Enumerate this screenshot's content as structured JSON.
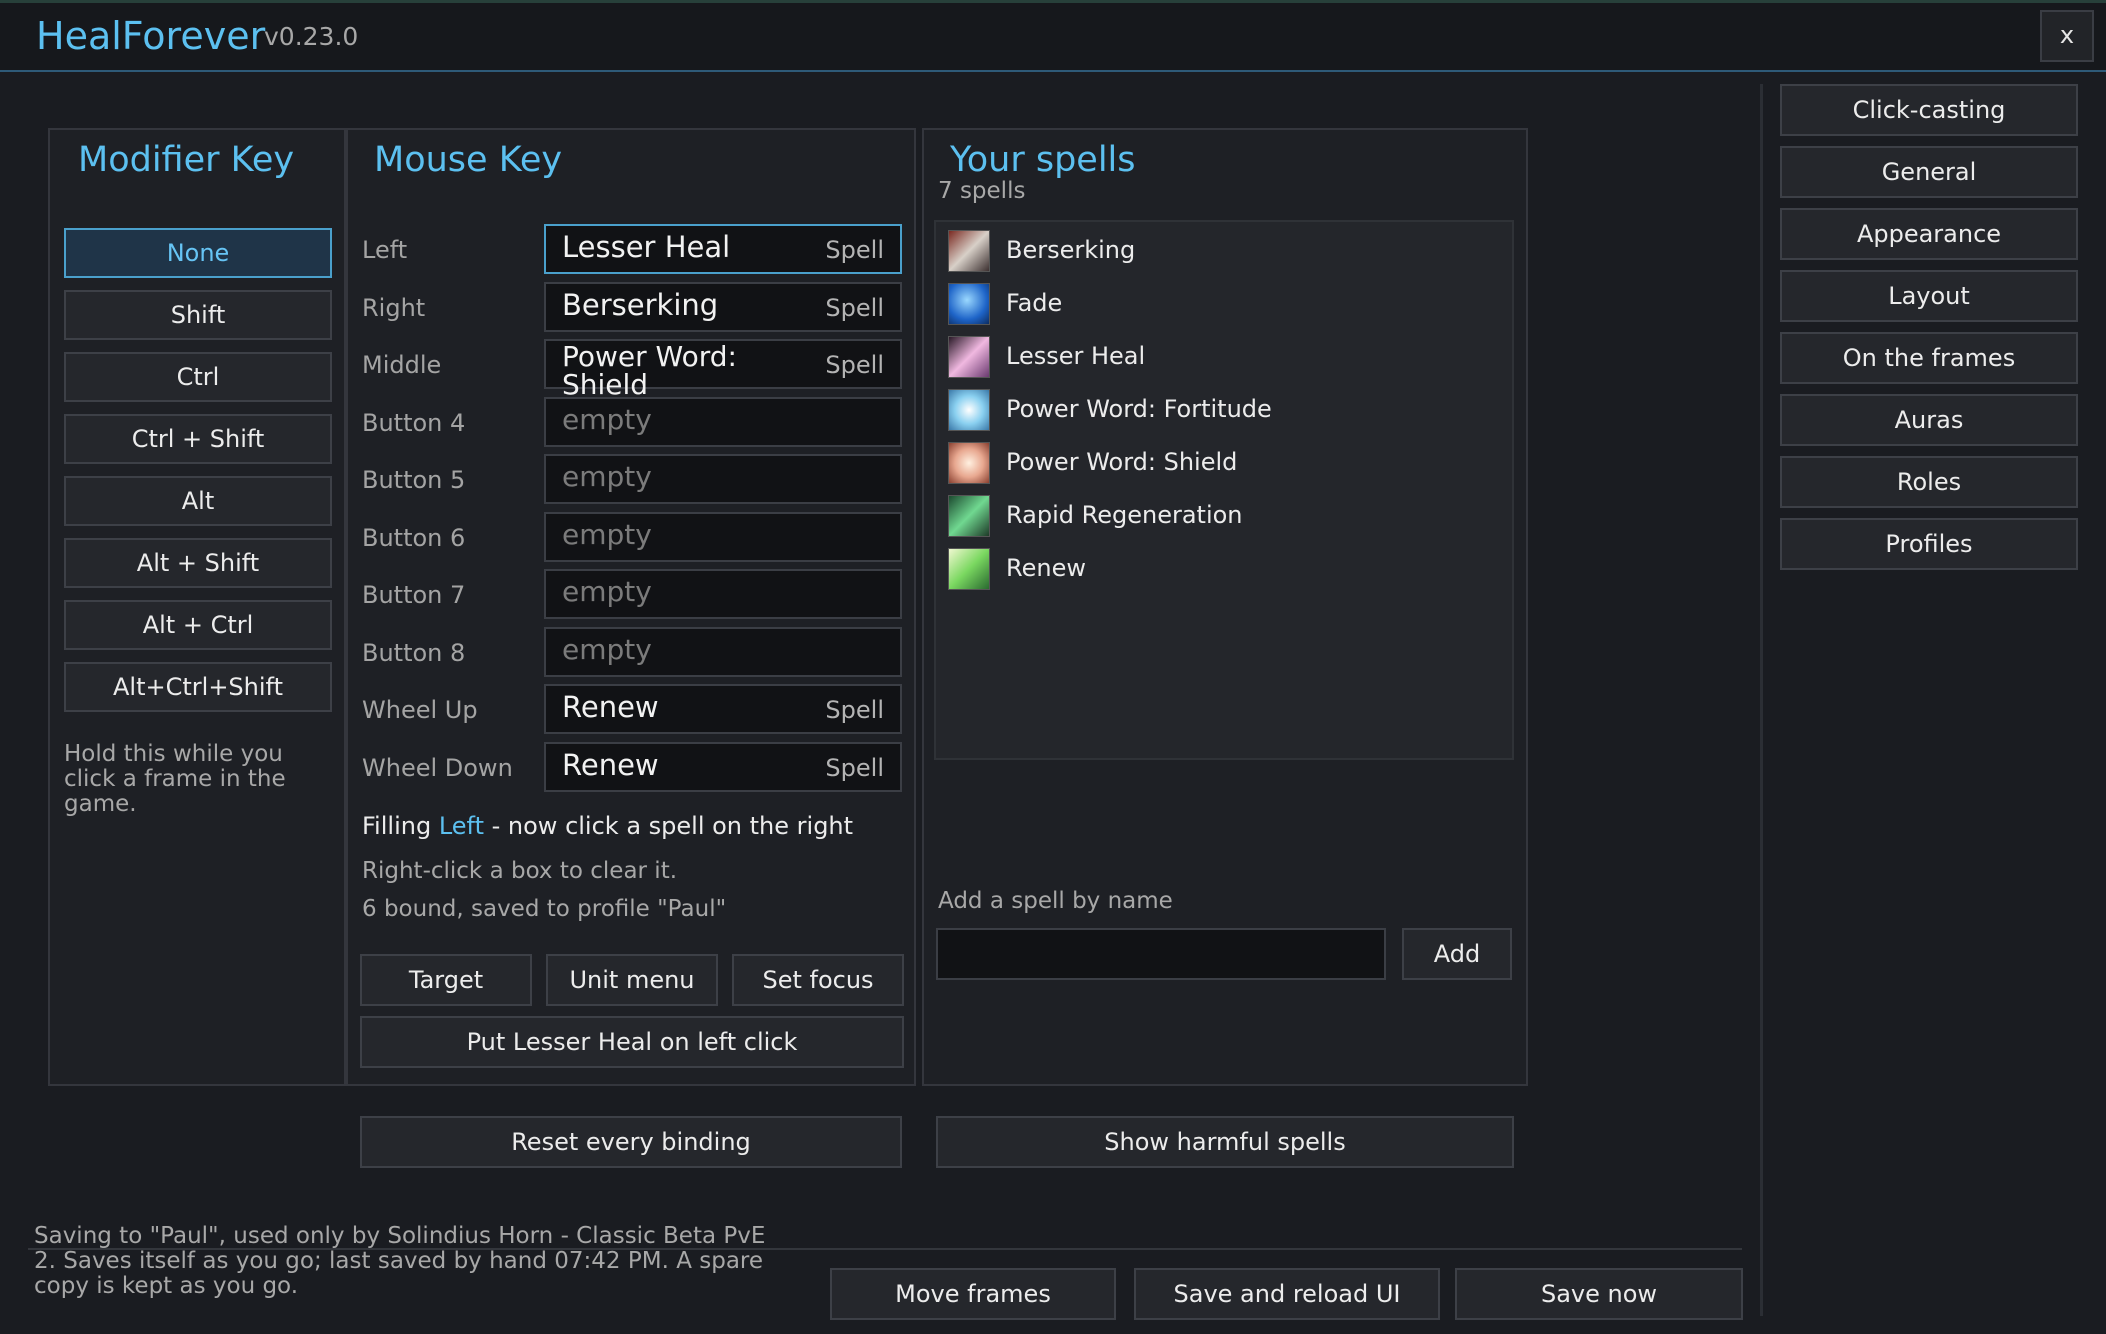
{
  "app": {
    "title": "HealForever",
    "version": "v0.23.0",
    "close_label": "x"
  },
  "modifier": {
    "title": "Modifier Key",
    "buttons": [
      "None",
      "Shift",
      "Ctrl",
      "Ctrl + Shift",
      "Alt",
      "Alt + Shift",
      "Alt + Ctrl",
      "Alt+Ctrl+Shift"
    ],
    "selected": "None",
    "hint_lines": [
      "Hold this while you",
      "click a frame in the",
      "game."
    ]
  },
  "mouse": {
    "title": "Mouse Key",
    "rows": [
      {
        "label": "Left",
        "spell": "Lesser Heal",
        "tag": "Spell"
      },
      {
        "label": "Right",
        "spell": "Berserking",
        "tag": "Spell"
      },
      {
        "label": "Middle",
        "spell_line1": "Power Word:",
        "spell_line2": "Shield",
        "tag": "Spell"
      },
      {
        "label": "Button 4",
        "empty": "empty"
      },
      {
        "label": "Button 5",
        "empty": "empty"
      },
      {
        "label": "Button 6",
        "empty": "empty"
      },
      {
        "label": "Button 7",
        "empty": "empty"
      },
      {
        "label": "Button 8",
        "empty": "empty"
      },
      {
        "label": "Wheel Up",
        "spell": "Renew",
        "tag": "Spell"
      },
      {
        "label": "Wheel Down",
        "spell": "Renew",
        "tag": "Spell"
      }
    ],
    "filling_prefix": "Filling",
    "filling_key": "Left",
    "filling_suffix": "- now click a spell on the right",
    "clear_hint": "Right-click a box to clear it.",
    "bound_status": "6 bound, saved to profile \"Paul\"",
    "target_label": "Target",
    "unit_menu_label": "Unit menu",
    "set_focus_label": "Set focus",
    "put_left_label": "Put Lesser Heal on left click"
  },
  "spells": {
    "title": "Your spells",
    "count": "7 spells",
    "list": [
      {
        "name": "Berserking",
        "icon": "berserking-icon"
      },
      {
        "name": "Fade",
        "icon": "fade-icon"
      },
      {
        "name": "Lesser Heal",
        "icon": "lesser-heal-icon"
      },
      {
        "name": "Power Word: Fortitude",
        "icon": "fortitude-icon"
      },
      {
        "name": "Power Word: Shield",
        "icon": "shield-icon"
      },
      {
        "name": "Rapid Regeneration",
        "icon": "regeneration-icon"
      },
      {
        "name": "Renew",
        "icon": "renew-icon"
      }
    ],
    "add_label": "Add a spell by name",
    "add_input_value": "",
    "add_button": "Add"
  },
  "actions": {
    "reset_label": "Reset every binding",
    "harmful_label": "Show harmful spells",
    "move_frames_label": "Move frames",
    "save_reload_label": "Save and reload UI",
    "save_now_label": "Save now"
  },
  "footer": {
    "lines": [
      "Saving to \"Paul\", used only by Solindius Horn - Classic Beta PvE",
      "2. Saves itself as you go; last saved by hand 07:42 PM. A spare",
      "copy is kept as you go."
    ]
  },
  "sidebar": {
    "items": [
      "Click-casting",
      "General",
      "Appearance",
      "Layout",
      "On the frames",
      "Auras",
      "Roles",
      "Profiles"
    ]
  },
  "colors": {
    "accent": "#5cc0f0",
    "panel": "#1e2025",
    "background": "#1a1c21"
  }
}
